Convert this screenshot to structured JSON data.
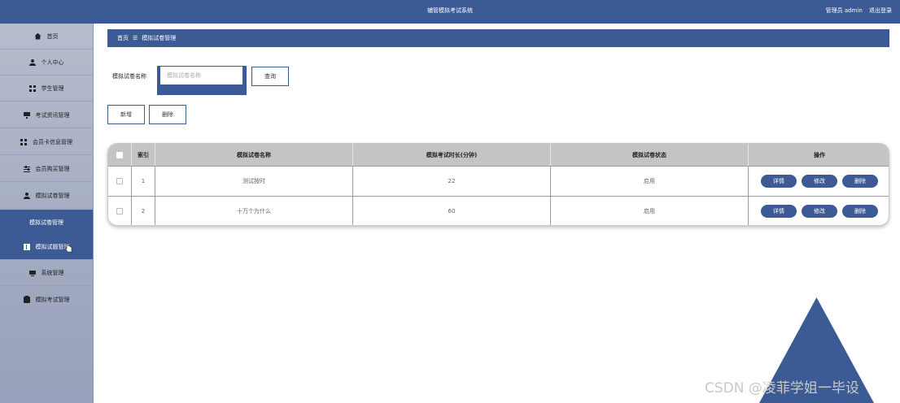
{
  "topbar": {
    "title": "辅管模拟考试系统",
    "user": "管理员 admin",
    "logout": "退出登录"
  },
  "sidebar": {
    "items": [
      {
        "label": "首页",
        "icon": "home-icon"
      },
      {
        "label": "个人中心",
        "icon": "user-icon"
      },
      {
        "label": "学生管理",
        "icon": "grid-icon"
      },
      {
        "label": "考试资讯管理",
        "icon": "monitor-icon"
      },
      {
        "label": "会员卡信息管理",
        "icon": "grid-icon"
      },
      {
        "label": "会员购买管理",
        "icon": "sliders-icon"
      },
      {
        "label": "模拟试卷管理",
        "icon": "user-icon"
      },
      {
        "label": "模拟试卷管理",
        "icon": ""
      },
      {
        "label": "模拟试题管理",
        "icon": "book-icon"
      },
      {
        "label": "系统管理",
        "icon": "system-icon"
      },
      {
        "label": "模拟考试管理",
        "icon": "clipboard-icon"
      }
    ]
  },
  "breadcrumb": {
    "home": "首页",
    "separator": "☰",
    "current": "模拟试卷管理"
  },
  "search": {
    "label": "模拟试卷名称",
    "placeholder": "模拟试卷名称",
    "value": "",
    "query_button": "查询"
  },
  "actions": {
    "add": "新增",
    "delete": "删除"
  },
  "table": {
    "headers": [
      "",
      "索引",
      "模拟试卷名称",
      "模拟考试时长(分钟)",
      "模拟试卷状态",
      "操作"
    ],
    "rows": [
      {
        "index": "1",
        "name": "测试按时",
        "duration": "22",
        "status": "启用"
      },
      {
        "index": "2",
        "name": "十万个为什么",
        "duration": "60",
        "status": "启用"
      }
    ],
    "row_actions": {
      "detail": "详情",
      "edit": "修改",
      "delete": "删除"
    }
  },
  "watermark": "CSDN @凌菲学姐一毕设",
  "colors": {
    "primary": "#3c5a94",
    "header_bg": "#c4c4c4",
    "sidebar_bg": "#b6bccd"
  }
}
